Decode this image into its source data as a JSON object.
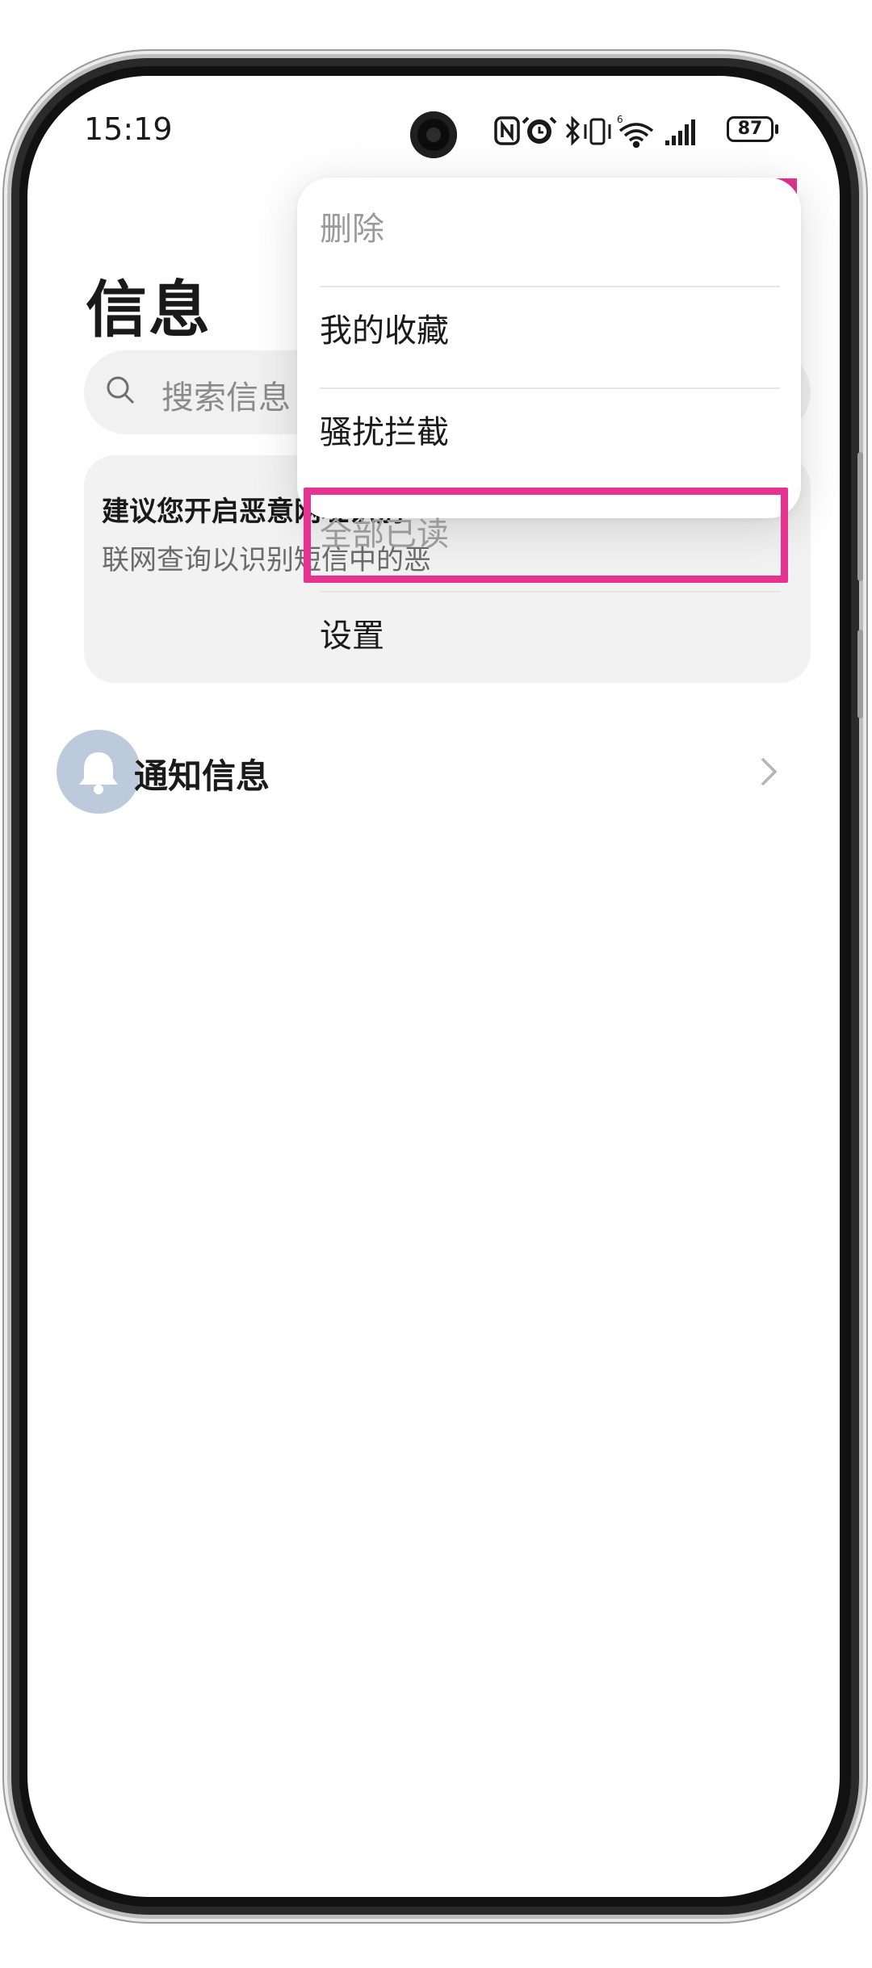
{
  "status_bar": {
    "time": "15:19",
    "battery_level": "87",
    "icons": [
      "nfc-icon",
      "alarm-icon",
      "bluetooth-icon",
      "vibrate-icon",
      "wifi-6-icon",
      "signal-icon",
      "battery-icon"
    ]
  },
  "header": {
    "title": "信息",
    "add_icon": "plus-icon",
    "more_icon": "more-dots-icon"
  },
  "search": {
    "placeholder": "搜索信息"
  },
  "tip_card": {
    "title": "建议您开启恶意网址识别",
    "description": "联网查询以识别短信中的恶"
  },
  "conversations": [
    {
      "label": "通知信息",
      "icon": "bell-icon"
    }
  ],
  "menu": {
    "items": [
      {
        "label": "删除",
        "enabled": false
      },
      {
        "label": "我的收藏",
        "enabled": true
      },
      {
        "label": "骚扰拦截",
        "enabled": true,
        "highlighted": true
      },
      {
        "label": "全部已读",
        "enabled": false
      },
      {
        "label": "设置",
        "enabled": true
      }
    ]
  },
  "colors": {
    "highlight": "#e6338f",
    "avatar_bg": "#bccadb",
    "card_bg": "#f2f2f2",
    "disabled_text": "#9a9a9a"
  }
}
